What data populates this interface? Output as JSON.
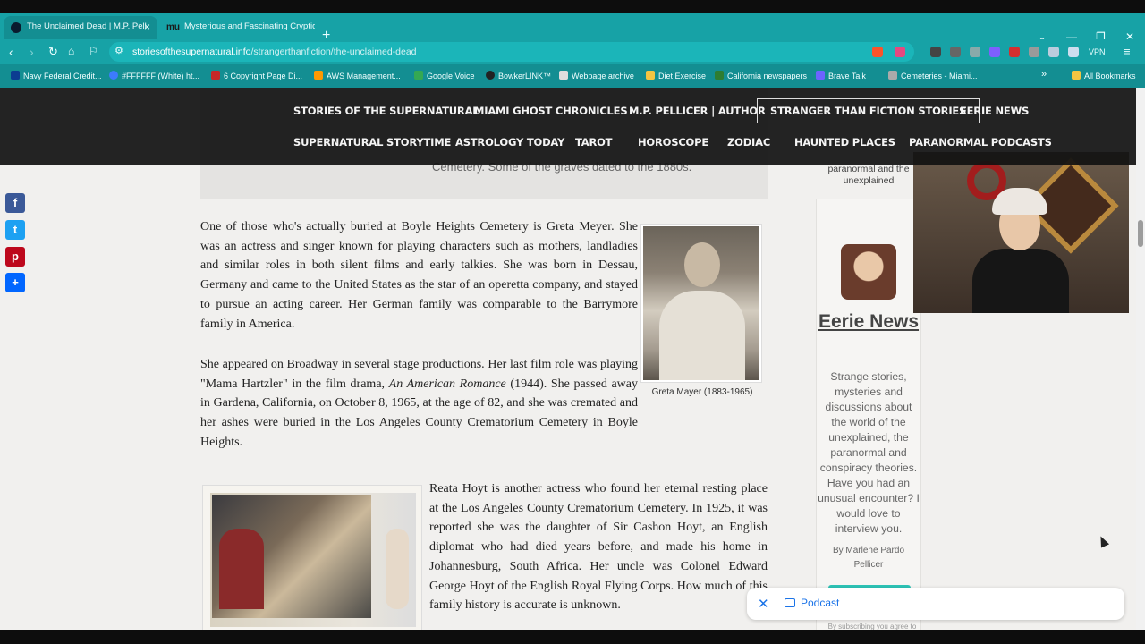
{
  "browser": {
    "tabs": [
      {
        "title": "The Unclaimed Dead | M.P. Pell",
        "active": true
      },
      {
        "title": "Mysterious and Fascinating Cryptid",
        "active": false
      }
    ],
    "url_host": "storiesofthesupernatural.info",
    "url_path": "/strangerthanfiction/the-unclaimed-dead",
    "vpn_label": "VPN",
    "bookmarks": [
      "Navy Federal Credit...",
      "#FFFFFF (White) ht...",
      "6 Copyright Page Di...",
      "AWS Management...",
      "Google Voice",
      "BowkerLINK™",
      "Webpage archive",
      "Diet Exercise",
      "California newspapers",
      "Brave Talk",
      "Cemeteries - Miami..."
    ],
    "all_bookmarks": "All Bookmarks"
  },
  "site_nav": {
    "row1": [
      "STORIES OF THE SUPERNATURAL",
      "MIAMI GHOST CHRONICLES",
      "M.P. PELLICER | AUTHOR",
      "STRANGER THAN FICTION STORIES",
      "EERIE NEWS"
    ],
    "row2": [
      "SUPERNATURAL STORYTIME",
      "ASTROLOGY TODAY",
      "TAROT",
      "HOROSCOPE",
      "ZODIAC",
      "HAUNTED PLACES",
      "PARANORMAL PODCASTS"
    ],
    "active": "STRANGER THAN FICTION STORIES"
  },
  "article": {
    "quote_tail": "Cemetery. Some of the graves dated to the 1880s.",
    "para1": "One of those who's actually buried at Boyle Heights Cemetery is Greta Meyer. She was an actress and singer known for playing characters such as mothers, landladies and similar roles in both silent films and early talkies. She was born in Dessau, Germany and came to the United States as the star of an operetta company, and stayed to pursue an acting career. Her German family was comparable to the Barrymore family in America.",
    "para2_a": "She appeared on Broadway in several stage productions. Her last film role was playing \"Mama Hartzler\" in the film drama, ",
    "para2_film": "An American Romance",
    "para2_b": " (1944). She passed away in Gardena, California, on October 8, 1965, at the age of 82, and she was cremated and her ashes were buried in the Los Angeles County Crematorium Cemetery in Boyle Heights.",
    "caption1": "Greta Mayer (1883-1965)",
    "para3": "Reata Hoyt is another actress who found her eternal resting place at the Los Angeles County Crematorium Cemetery. In 1925, it was reported she was the daughter of Sir Cashon Hoyt, an English diplomat who had died years before, and made his home in Johannesburg, South Africa. Her uncle was Colonel Edward George Hoyt of the English Royal Flying Corps. How much of this family history is accurate is unknown."
  },
  "sidebar": {
    "tagline": "paranormal and the unexplained",
    "title": "Eerie News",
    "description": "Strange stories, mysteries and discussions about the world of the unexplained, the paranormal and conspiracy theories. Have you had an unusual encounter? I would love to interview you.",
    "byline": "By Marlene Pardo Pellicer",
    "subscribe_note": "By subscribing you agree to"
  },
  "podcast_bar": {
    "label": "Podcast"
  },
  "colors": {
    "chrome": "#17a2a6",
    "nav_bg": "#111111",
    "page_bg": "#f1f0ee"
  }
}
